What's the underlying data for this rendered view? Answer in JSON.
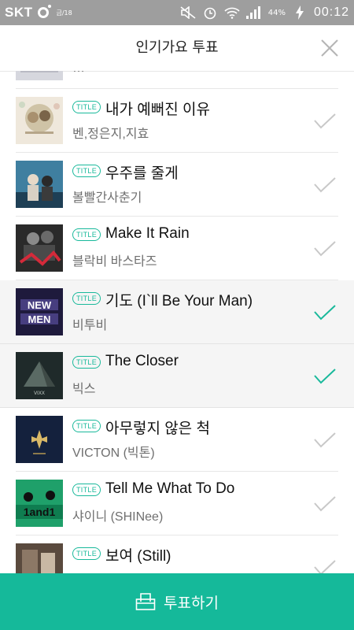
{
  "status_bar": {
    "carrier": "SKT",
    "date": "금/18",
    "battery": "44%",
    "time": "00:12"
  },
  "header": {
    "title": "인기가요 투표"
  },
  "list": {
    "badge": "TITLE",
    "partial_top_text": "…",
    "songs": [
      {
        "title": "내가 예뻐진 이유",
        "artist": "벤,정은지,지효",
        "selected": false
      },
      {
        "title": "우주를 줄게",
        "artist": "볼빨간사춘기",
        "selected": false
      },
      {
        "title": "Make It Rain",
        "artist": "블락비 바스타즈",
        "selected": false
      },
      {
        "title": "기도 (I`ll Be Your Man)",
        "artist": "비투비",
        "selected": true
      },
      {
        "title": "The Closer",
        "artist": "빅스",
        "selected": true
      },
      {
        "title": "아무렇지 않은 척",
        "artist": "VICTON (빅톤)",
        "selected": false
      },
      {
        "title": "Tell Me What To Do",
        "artist": "샤이니 (SHINee)",
        "selected": false
      },
      {
        "title": "보여 (Still)",
        "artist": "",
        "selected": false
      }
    ]
  },
  "footer": {
    "vote_label": "투표하기"
  },
  "colors": {
    "accent": "#15b99a",
    "check_selected": "#19b99b",
    "check_unselected": "#c8c8c8"
  }
}
